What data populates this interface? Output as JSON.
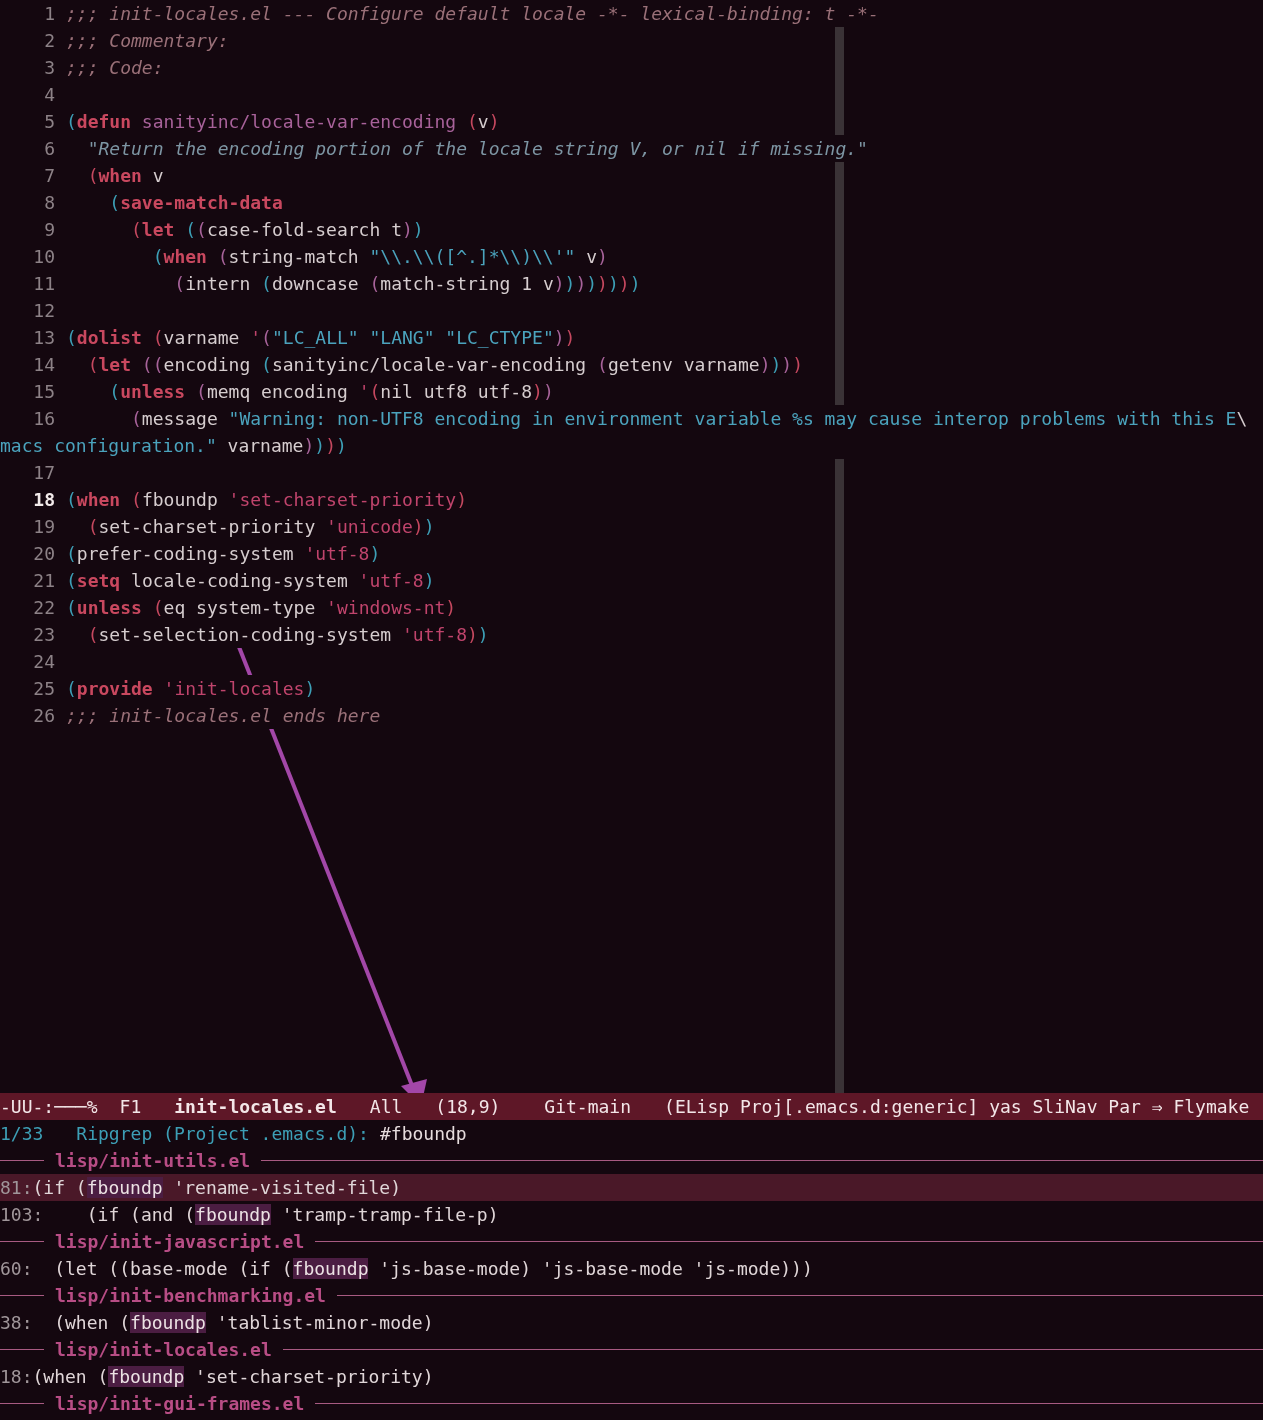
{
  "editor": {
    "lines": [
      {
        "number": "1",
        "current": false,
        "tokens": [
          {
            "kind": "comment",
            "text": ";;; init-locales.el --- Configure default locale -*- lexical-binding: t -*-"
          }
        ]
      },
      {
        "number": "2",
        "current": false,
        "tokens": [
          {
            "kind": "comment",
            "text": ";;; Commentary:"
          }
        ]
      },
      {
        "number": "3",
        "current": false,
        "tokens": [
          {
            "kind": "comment",
            "text": ";;; Code:"
          }
        ]
      },
      {
        "number": "4",
        "current": false
      },
      {
        "number": "5",
        "current": false,
        "tokens": [
          {
            "kind": "paren-a",
            "text": "("
          },
          {
            "kind": "keyword",
            "text": "defun"
          },
          {
            "kind": "function-name",
            "text": " sanityinc/locale-var-encoding"
          },
          {
            "kind": "paren-b",
            "text": " ("
          },
          {
            "kind": "plain",
            "text": "v"
          },
          {
            "kind": "paren-b",
            "text": ")"
          }
        ]
      },
      {
        "number": "6",
        "current": false,
        "tokens": [
          {
            "kind": "docstring",
            "text": "  \"Return the encoding portion of the locale string V, or nil if missing.\""
          }
        ]
      },
      {
        "number": "7",
        "current": false,
        "tokens": [
          {
            "kind": "paren-b",
            "text": "  ("
          },
          {
            "kind": "keyword",
            "text": "when"
          },
          {
            "kind": "plain",
            "text": " v"
          }
        ]
      },
      {
        "number": "8",
        "current": false,
        "tokens": [
          {
            "kind": "paren-a",
            "text": "    ("
          },
          {
            "kind": "keyword",
            "text": "save-match-data"
          }
        ]
      },
      {
        "number": "9",
        "current": false,
        "tokens": [
          {
            "kind": "paren-b",
            "text": "      ("
          },
          {
            "kind": "keyword",
            "text": "let"
          },
          {
            "kind": "paren-a",
            "text": " ("
          },
          {
            "kind": "paren-c",
            "text": "("
          },
          {
            "kind": "plain",
            "text": "case-fold-search t"
          },
          {
            "kind": "paren-c",
            "text": ")"
          },
          {
            "kind": "paren-a",
            "text": ")"
          }
        ]
      },
      {
        "number": "10",
        "current": false,
        "tokens": [
          {
            "kind": "paren-a",
            "text": "        ("
          },
          {
            "kind": "keyword",
            "text": "when"
          },
          {
            "kind": "paren-c",
            "text": " ("
          },
          {
            "kind": "plain",
            "text": "string-match"
          },
          {
            "kind": "string",
            "text": " \"\\\\.\\\\([^.]*\\\\)\\\\'\""
          },
          {
            "kind": "plain",
            "text": " v"
          },
          {
            "kind": "paren-c",
            "text": ")"
          }
        ]
      },
      {
        "number": "11",
        "current": false,
        "tokens": [
          {
            "kind": "paren-c",
            "text": "          ("
          },
          {
            "kind": "plain",
            "text": "intern"
          },
          {
            "kind": "paren-a",
            "text": " ("
          },
          {
            "kind": "plain",
            "text": "downcase"
          },
          {
            "kind": "paren-c",
            "text": " ("
          },
          {
            "kind": "plain",
            "text": "match-string 1 v"
          },
          {
            "kind": "paren-c",
            "text": ")"
          },
          {
            "kind": "paren-a",
            "text": ")"
          },
          {
            "kind": "paren-c",
            "text": ")"
          },
          {
            "kind": "paren-a",
            "text": ")"
          },
          {
            "kind": "paren-b",
            "text": ")"
          },
          {
            "kind": "paren-a",
            "text": ")"
          },
          {
            "kind": "paren-b",
            "text": ")"
          },
          {
            "kind": "paren-a",
            "text": ")"
          }
        ]
      },
      {
        "number": "12",
        "current": false
      },
      {
        "number": "13",
        "current": false,
        "tokens": [
          {
            "kind": "paren-a",
            "text": "("
          },
          {
            "kind": "keyword",
            "text": "dolist"
          },
          {
            "kind": "paren-b",
            "text": " ("
          },
          {
            "kind": "plain",
            "text": "varname"
          },
          {
            "kind": "quoted",
            "text": " '"
          },
          {
            "kind": "paren-c",
            "text": "("
          },
          {
            "kind": "string",
            "text": "\"LC_ALL\" \"LANG\" \"LC_CTYPE\""
          },
          {
            "kind": "paren-c",
            "text": ")"
          },
          {
            "kind": "paren-b",
            "text": ")"
          }
        ]
      },
      {
        "number": "14",
        "current": false,
        "tokens": [
          {
            "kind": "paren-b",
            "text": "  ("
          },
          {
            "kind": "keyword",
            "text": "let"
          },
          {
            "kind": "paren-c",
            "text": " (("
          },
          {
            "kind": "plain",
            "text": "encoding"
          },
          {
            "kind": "paren-a",
            "text": " ("
          },
          {
            "kind": "plain",
            "text": "sanityinc/locale-var-encoding"
          },
          {
            "kind": "paren-c",
            "text": " ("
          },
          {
            "kind": "plain",
            "text": "getenv varname"
          },
          {
            "kind": "paren-c",
            "text": ")"
          },
          {
            "kind": "paren-a",
            "text": ")"
          },
          {
            "kind": "paren-c",
            "text": ")"
          },
          {
            "kind": "paren-b",
            "text": ")"
          }
        ]
      },
      {
        "number": "15",
        "current": false,
        "tokens": [
          {
            "kind": "paren-a",
            "text": "    ("
          },
          {
            "kind": "keyword",
            "text": "unless"
          },
          {
            "kind": "paren-c",
            "text": " ("
          },
          {
            "kind": "plain",
            "text": "memq encoding"
          },
          {
            "kind": "quoted",
            "text": " '"
          },
          {
            "kind": "paren-b",
            "text": "("
          },
          {
            "kind": "plain",
            "text": "nil utf8 utf-8"
          },
          {
            "kind": "paren-b",
            "text": ")"
          },
          {
            "kind": "paren-c",
            "text": ")"
          }
        ]
      },
      {
        "number": "16",
        "current": false,
        "tokens": [
          {
            "kind": "paren-c",
            "text": "      ("
          },
          {
            "kind": "plain",
            "text": "message"
          },
          {
            "kind": "string",
            "text": " \"Warning: non-UTF8 encoding in environment variable %s may cause interop problems with this E"
          },
          {
            "kind": "plain",
            "text": "\\"
          }
        ],
        "wrapped": [
          {
            "kind": "string",
            "text": "macs configuration.\""
          },
          {
            "kind": "plain",
            "text": " varname"
          },
          {
            "kind": "paren-c",
            "text": ")"
          },
          {
            "kind": "paren-a",
            "text": ")"
          },
          {
            "kind": "paren-b",
            "text": ")"
          },
          {
            "kind": "paren-a",
            "text": ")"
          }
        ]
      },
      {
        "number": "17",
        "current": false
      },
      {
        "number": "18",
        "current": true,
        "tokens": [
          {
            "kind": "paren-a",
            "text": "("
          },
          {
            "kind": "keyword",
            "text": "when"
          },
          {
            "kind": "paren-b",
            "text": " ("
          },
          {
            "kind": "plain",
            "text": "fboundp"
          },
          {
            "kind": "quoted",
            "text": " 'set-charset-priority"
          },
          {
            "kind": "paren-b",
            "text": ")"
          }
        ]
      },
      {
        "number": "19",
        "current": false,
        "tokens": [
          {
            "kind": "paren-b",
            "text": "  ("
          },
          {
            "kind": "plain",
            "text": "set-charset-priority"
          },
          {
            "kind": "quoted",
            "text": " 'unicode"
          },
          {
            "kind": "paren-b",
            "text": ")"
          },
          {
            "kind": "paren-a",
            "text": ")"
          }
        ]
      },
      {
        "number": "20",
        "current": false,
        "tokens": [
          {
            "kind": "paren-a",
            "text": "("
          },
          {
            "kind": "plain",
            "text": "prefer-coding-system"
          },
          {
            "kind": "quoted",
            "text": " 'utf-8"
          },
          {
            "kind": "paren-a",
            "text": ")"
          }
        ]
      },
      {
        "number": "21",
        "current": false,
        "tokens": [
          {
            "kind": "paren-a",
            "text": "("
          },
          {
            "kind": "keyword",
            "text": "setq"
          },
          {
            "kind": "plain",
            "text": " locale-coding-system"
          },
          {
            "kind": "quoted",
            "text": " 'utf-8"
          },
          {
            "kind": "paren-a",
            "text": ")"
          }
        ]
      },
      {
        "number": "22",
        "current": false,
        "tokens": [
          {
            "kind": "paren-a",
            "text": "("
          },
          {
            "kind": "keyword",
            "text": "unless"
          },
          {
            "kind": "paren-b",
            "text": " ("
          },
          {
            "kind": "plain",
            "text": "eq system-type"
          },
          {
            "kind": "quoted",
            "text": " 'windows-nt"
          },
          {
            "kind": "paren-b",
            "text": ")"
          }
        ]
      },
      {
        "number": "23",
        "current": false,
        "tokens": [
          {
            "kind": "paren-b",
            "text": "  ("
          },
          {
            "kind": "plain",
            "text": "set-selection-coding-system"
          },
          {
            "kind": "quoted",
            "text": " 'utf-8"
          },
          {
            "kind": "paren-b",
            "text": ")"
          },
          {
            "kind": "paren-a",
            "text": ")"
          }
        ]
      },
      {
        "number": "24",
        "current": false
      },
      {
        "number": "25",
        "current": false,
        "tokens": [
          {
            "kind": "paren-a",
            "text": "("
          },
          {
            "kind": "keyword",
            "text": "provide"
          },
          {
            "kind": "quoted",
            "text": " 'init-locales"
          },
          {
            "kind": "paren-a",
            "text": ")"
          }
        ]
      },
      {
        "number": "26",
        "current": false,
        "tokens": [
          {
            "kind": "comment",
            "text": ";;; init-locales.el ends here"
          }
        ]
      }
    ]
  },
  "mode_line": [
    {
      "kind": "status",
      "text": "-UU-:───%"
    },
    {
      "kind": "status",
      "text": "F1"
    },
    {
      "kind": "buffer-name",
      "text": "init-locales.el"
    },
    {
      "kind": "status",
      "text": "All"
    },
    {
      "kind": "status",
      "text": "(18,9)"
    },
    {
      "kind": "status",
      "text": "Git-main"
    },
    {
      "kind": "status",
      "text": "(ELisp Proj[.emacs.d:generic] yas SliNav Par ⇒ Flymake"
    }
  ],
  "minibuffer": {
    "counter": "1/33",
    "prompt": "Ripgrep (Project .emacs.d):",
    "query": "#fboundp"
  },
  "results": [
    {
      "file": "lisp/init-utils.el",
      "rows": [
        {
          "line": "81:",
          "before": "(if (",
          "match": "fboundp",
          "after": " 'rename-visited-file)",
          "selected": true
        },
        {
          "line": "103:",
          "before": "    (if (and (",
          "match": "fboundp",
          "after": " 'tramp-tramp-file-p)",
          "selected": false
        }
      ]
    },
    {
      "file": "lisp/init-javascript.el",
      "rows": [
        {
          "line": "60:",
          "before": "  (let ((base-mode (if (",
          "match": "fboundp",
          "after": " 'js-base-mode) 'js-base-mode 'js-mode)))",
          "selected": false
        }
      ]
    },
    {
      "file": "lisp/init-benchmarking.el",
      "rows": [
        {
          "line": "38:",
          "before": "  (when (",
          "match": "fboundp",
          "after": " 'tablist-minor-mode)",
          "selected": false
        }
      ]
    },
    {
      "file": "lisp/init-locales.el",
      "rows": [
        {
          "line": "18:",
          "before": "(when (",
          "match": "fboundp",
          "after": " 'set-charset-priority)",
          "selected": false
        }
      ]
    },
    {
      "file": "lisp/init-gui-frames.el"
    }
  ]
}
